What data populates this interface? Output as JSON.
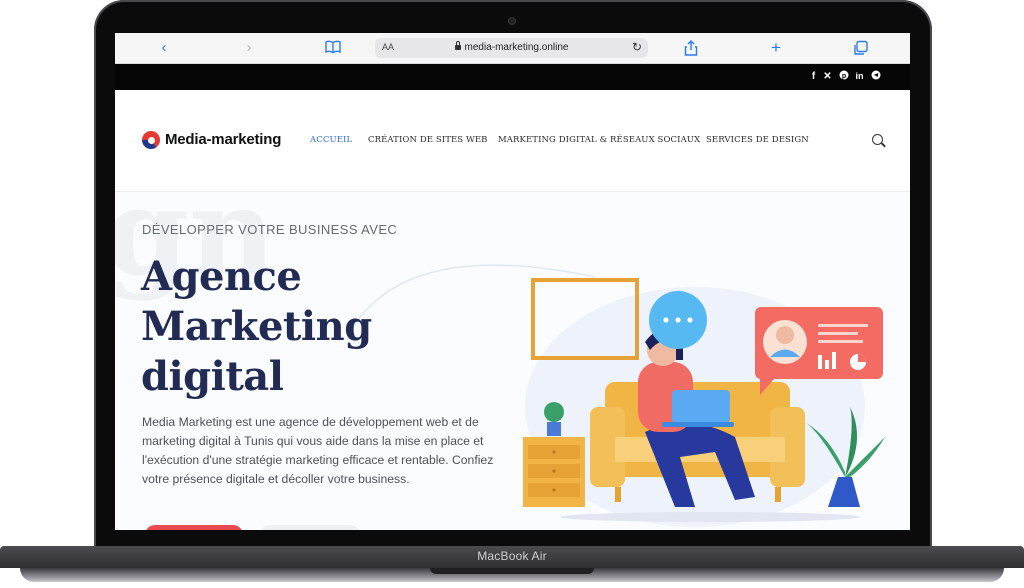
{
  "device": {
    "label": "MacBook Air"
  },
  "browser": {
    "address_prefix": "AA",
    "url": "media-marketing.online"
  },
  "social": {
    "icons": [
      "facebook-icon",
      "x-icon",
      "pinterest-icon",
      "linkedin-icon",
      "telegram-icon"
    ]
  },
  "nav": {
    "brand": "Media-marketing",
    "items": [
      {
        "label": "ACCUEIL",
        "active": true
      },
      {
        "label": "CRÉATION DE SITES WEB",
        "active": false
      },
      {
        "label": "MARKETING DIGITAL & RÉSEAUX SOCIAUX",
        "active": false
      },
      {
        "label": "SERVICES DE DESIGN",
        "active": false
      }
    ]
  },
  "hero": {
    "eyebrow": "DÉVELOPPER VOTRE BUSINESS AVEC",
    "headline_1": "Agence",
    "headline_2": "Marketing",
    "headline_3": "digital",
    "description": "Media Marketing est une agence de développement web et de marketing digital à Tunis qui vous aide dans la mise en place et l'exécution d'une stratégie marketing efficace et rentable. Confiez votre présence digitale et décoller votre business."
  },
  "colors": {
    "accent": "#2b6cd8",
    "headline": "#222b54",
    "cta": "#e84a4f"
  }
}
